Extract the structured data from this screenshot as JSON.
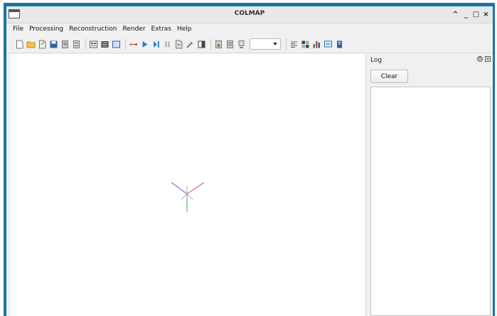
{
  "window": {
    "title": "COLMAP",
    "controls": {
      "maximize_glyph": "^",
      "minimize_glyph": "_",
      "restore_glyph": "□",
      "close_glyph": "×"
    }
  },
  "menu": {
    "items": [
      "File",
      "Processing",
      "Reconstruction",
      "Render",
      "Extras",
      "Help"
    ]
  },
  "toolbar": {
    "combo_value": "",
    "icons": [
      "new-project-icon",
      "open-project-icon",
      "edit-project-icon",
      "save-project-icon",
      "import-model-icon",
      "export-model-icon",
      "database-icon",
      "feature-extraction-icon",
      "feature-matching-icon",
      "reconstruction-start-icon",
      "play-icon",
      "step-icon",
      "pause-icon",
      "reset-icon",
      "bundle-adjustment-icon",
      "dense-reconstruction-icon",
      "render-options-icon",
      "render-toggle-icon",
      "reset-view-icon",
      "log-icon",
      "match-matrix-icon",
      "statistics-icon",
      "undistort-icon",
      "documentation-icon"
    ]
  },
  "log": {
    "title": "Log",
    "clear_label": "Clear",
    "float_glyph": "◎",
    "close_glyph": "×"
  },
  "colors": {
    "axis_x": "#d8638a",
    "axis_y": "#57bd57",
    "axis_z": "#7f6bd1",
    "window_border": "#1a72a8"
  }
}
